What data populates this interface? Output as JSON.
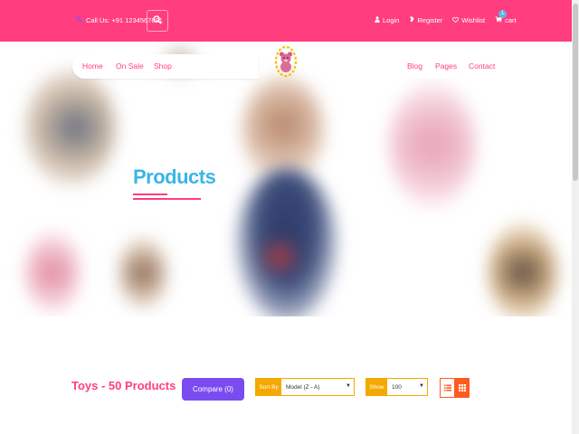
{
  "topbar": {
    "call_text": "Call Us: +91 1234567891",
    "links": {
      "login": "Login",
      "register": "Register",
      "wishlist": "Wishlist",
      "cart": "cart",
      "cart_count": "1"
    }
  },
  "nav": {
    "home": "Home",
    "on_sale": "On Sale",
    "shop": "Shop",
    "blog": "Blog",
    "pages": "Pages",
    "contact": "Contact"
  },
  "hero": {
    "title": "Products"
  },
  "toolbar": {
    "category_title": "Toys - 50 Products",
    "compare_label": "Compare (0)",
    "sort_label": "Sort By",
    "sort_value": "Model (Z - A)",
    "show_label": "Show",
    "show_value": "100"
  },
  "colors": {
    "brand_pink": "#ff3d7f",
    "title_blue": "#3ab5e6",
    "compare_purple": "#7a4cf0",
    "select_orange": "#f5a800",
    "view_orange": "#ff5a1f"
  },
  "icons": [
    "phone-icon",
    "search-icon",
    "user-icon",
    "register-icon",
    "heart-icon",
    "cart-icon",
    "list-view-icon",
    "grid-view-icon"
  ]
}
